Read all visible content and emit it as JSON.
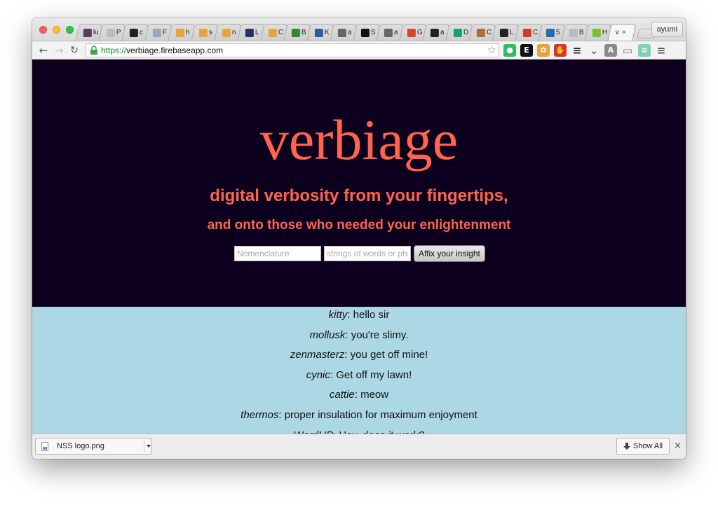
{
  "browser": {
    "profile_name": "ayumi",
    "tabs": [
      {
        "favicon": "slack-icon",
        "color": "#5b3c5e",
        "title": "lu"
      },
      {
        "favicon": "document-icon",
        "color": "#bbbbbb",
        "title": "P"
      },
      {
        "favicon": "github-icon",
        "color": "#222222",
        "title": "c"
      },
      {
        "favicon": "gem-icon",
        "color": "#9aa9b8",
        "title": "F"
      },
      {
        "favicon": "bar-chart-icon",
        "color": "#e8a33a",
        "title": "h"
      },
      {
        "favicon": "bar-chart-icon",
        "color": "#e8a33a",
        "title": "s"
      },
      {
        "favicon": "bar-chart-icon",
        "color": "#e8a33a",
        "title": "n"
      },
      {
        "favicon": "avatar-icon",
        "color": "#223366",
        "title": "L"
      },
      {
        "favicon": "bar-chart-icon",
        "color": "#e8a33a",
        "title": "C"
      },
      {
        "favicon": "vim-icon",
        "color": "#2e8b2e",
        "title": "B"
      },
      {
        "favicon": "l-logo-icon",
        "color": "#2d5e9e",
        "title": "K"
      },
      {
        "favicon": "keyboard-icon",
        "color": "#666666",
        "title": "a"
      },
      {
        "favicon": "slash-circle-icon",
        "color": "#111111",
        "title": "S"
      },
      {
        "favicon": "keyboard-icon",
        "color": "#666666",
        "title": "a"
      },
      {
        "favicon": "red-square-icon",
        "color": "#d9432f",
        "title": "G"
      },
      {
        "favicon": "github-icon",
        "color": "#222222",
        "title": "a"
      },
      {
        "favicon": "drop-icon",
        "color": "#1aa06a",
        "title": "D"
      },
      {
        "favicon": "dog-icon",
        "color": "#b06a3a",
        "title": "C"
      },
      {
        "favicon": "github-icon",
        "color": "#222222",
        "title": "L"
      },
      {
        "favicon": "info-icon",
        "color": "#d23b2b",
        "title": "C"
      },
      {
        "favicon": "h-logo-icon",
        "color": "#1f6db3",
        "title": "5"
      },
      {
        "favicon": "document-icon",
        "color": "#bbbbbb",
        "title": "B"
      },
      {
        "favicon": "html-icon",
        "color": "#7cc12b",
        "title": "H"
      }
    ],
    "active_tab": {
      "title": "v",
      "close": "×"
    },
    "url_scheme": "https://",
    "url_host": "verbiage.firebaseapp.com",
    "extensions": [
      {
        "name": "evernote-icon",
        "color": "#2dbe60",
        "glyph": "●"
      },
      {
        "name": "e-extension-icon",
        "color": "#111111",
        "glyph": "E"
      },
      {
        "name": "flower-icon",
        "color": "#e8a23a",
        "glyph": "✿"
      },
      {
        "name": "adblock-icon",
        "color": "#d9362b",
        "glyph": "✋"
      },
      {
        "name": "buffer-icon",
        "color": "#222222",
        "glyph": "≡"
      },
      {
        "name": "pocket-icon",
        "color": "#666666",
        "glyph": "⌄"
      },
      {
        "name": "angular-icon",
        "color": "#8a8a8a",
        "glyph": "A"
      },
      {
        "name": "cast-icon",
        "color": "#777777",
        "glyph": "▭"
      },
      {
        "name": "soundcloud-icon",
        "color": "#7fd1b5",
        "glyph": "≋"
      },
      {
        "name": "menu-icon",
        "color": "#555555",
        "glyph": "≡"
      }
    ]
  },
  "app": {
    "logo": "verbiage",
    "tagline_1": "digital verbosity from your fingertips,",
    "tagline_2": "and onto those who needed your enlightenment",
    "name_placeholder": "Nomenclature",
    "message_placeholder": "strings of words or phrases",
    "submit_label": "Affix your insight",
    "colors": {
      "background": "#0d001f",
      "accent": "#ff644e",
      "feed": "#acd7e4"
    },
    "messages": [
      {
        "author": "kitty",
        "text": ": hello sir"
      },
      {
        "author": "mollusk",
        "text": ": you're slimy."
      },
      {
        "author": "zenmasterz",
        "text": ": you get off mine!"
      },
      {
        "author": "cynic",
        "text": ": Get off my lawn!"
      },
      {
        "author": "cattie",
        "text": ": meow"
      },
      {
        "author": "thermos",
        "text": ": proper insulation for maximum enjoyment"
      },
      {
        "author": "WordUP",
        "text": ": Hey, does it work?"
      }
    ]
  },
  "downloads": {
    "file_name": "NSS logo.png",
    "show_all_label": "Show All",
    "close": "×"
  }
}
